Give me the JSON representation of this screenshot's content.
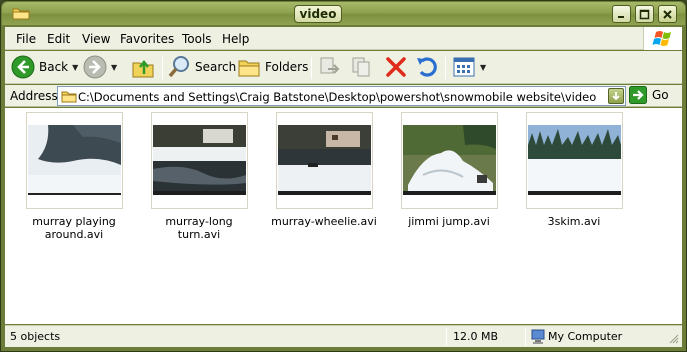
{
  "window": {
    "title": "video"
  },
  "menu": [
    "File",
    "Edit",
    "View",
    "Favorites",
    "Tools",
    "Help"
  ],
  "toolbar": {
    "back_label": "Back",
    "search_label": "Search",
    "folders_label": "Folders"
  },
  "address": {
    "label": "Address",
    "path": "C:\\Documents and Settings\\Craig Batstone\\Desktop\\powershot\\snowmobile website\\video",
    "go_label": "Go"
  },
  "files": [
    {
      "name": "murray playing around.avi",
      "line1": "murray playing",
      "line2": "around.avi"
    },
    {
      "name": "murray-long turn.avi",
      "line1": "murray-long turn.avi",
      "line2": ""
    },
    {
      "name": "murray-wheelie.avi",
      "line1": "murray-wheelie.avi",
      "line2": ""
    },
    {
      "name": "jimmi jump.avi",
      "line1": "jimmi jump.avi",
      "line2": ""
    },
    {
      "name": "3skim.avi",
      "line1": "3skim.avi",
      "line2": ""
    }
  ],
  "status": {
    "objects": "5 objects",
    "size": "12.0 MB",
    "location": "My Computer"
  },
  "colors": {
    "title_bar": "#8ea24f",
    "frame": "#6c7d3a",
    "chrome": "#eef0e2",
    "delete_red": "#e02a1a"
  }
}
